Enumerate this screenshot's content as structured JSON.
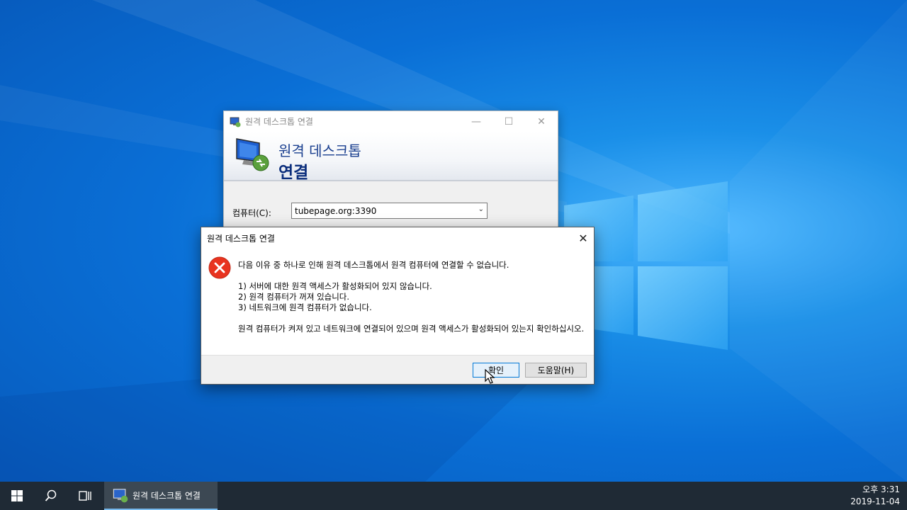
{
  "rdp_window": {
    "title": "원격 데스크톱 연결",
    "banner_line1": "원격 데스크톱",
    "banner_line2": "연결",
    "computer_label": "컴퓨터(C):",
    "computer_value": "tubepage.org:3390"
  },
  "error_dialog": {
    "title": "원격 데스크톱 연결",
    "message_intro": "다음 이유 중 하나로 인해 원격 데스크톱에서 원격 컴퓨터에 연결할 수 없습니다.",
    "reasons": [
      "1) 서버에 대한 원격 액세스가 활성화되어 있지 않습니다.",
      "2) 원격 컴퓨터가 꺼져 있습니다.",
      "3) 네트워크에 원격 컴퓨터가 없습니다."
    ],
    "message_outro": "원격 컴퓨터가 켜져 있고 네트워크에 연결되어 있으며 원격 액세스가 활성화되어 있는지 확인하십시오.",
    "ok_label": "확인",
    "help_label": "도움말(H)"
  },
  "taskbar": {
    "app_label": "원격 데스크톱 연결",
    "clock_time": "오후 3:31",
    "clock_date": "2019-11-04"
  },
  "colors": {
    "accent": "#0078d7",
    "taskbar": "#1f2a35",
    "error_red": "#e81123"
  },
  "icons": {
    "start": "windows-start-icon",
    "search": "search-icon",
    "task_view": "task-view-icon",
    "rdp": "remote-desktop-icon",
    "error": "error-icon"
  }
}
